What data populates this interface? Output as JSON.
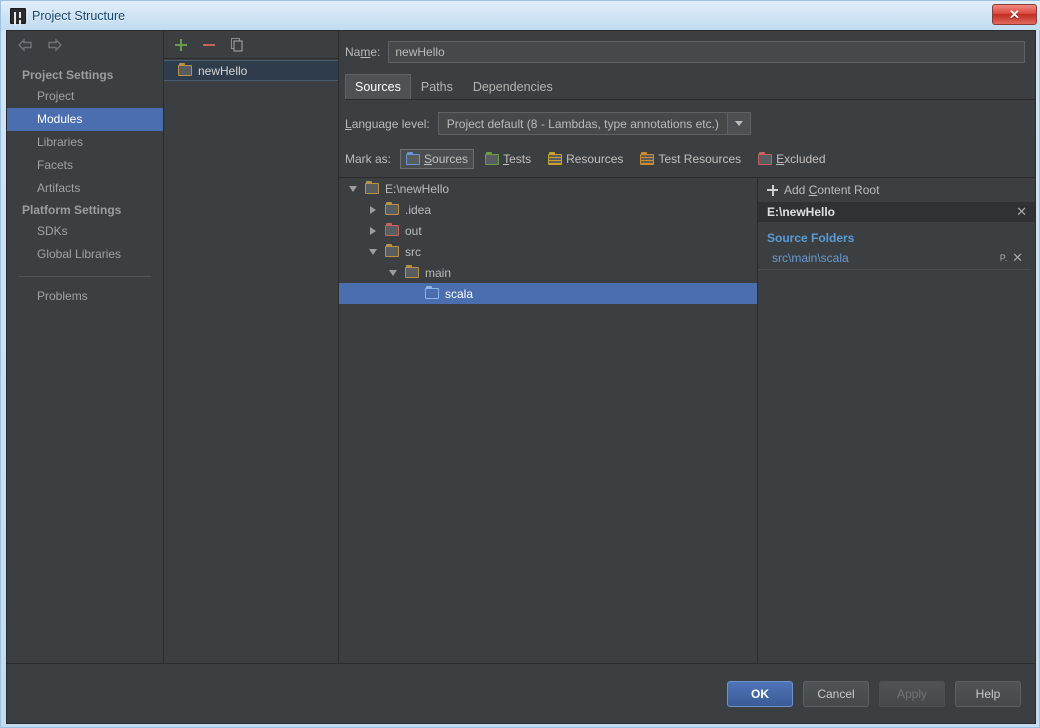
{
  "window": {
    "title": "Project Structure",
    "app_icon": "intellij-idea-icon",
    "close_label": "✕"
  },
  "sidebar": {
    "back_icon": "back-arrow-icon",
    "forward_icon": "forward-arrow-icon",
    "groups": [
      {
        "title": "Project Settings",
        "items": [
          {
            "label": "Project",
            "selected": false
          },
          {
            "label": "Modules",
            "selected": true
          },
          {
            "label": "Libraries",
            "selected": false
          },
          {
            "label": "Facets",
            "selected": false
          },
          {
            "label": "Artifacts",
            "selected": false
          }
        ]
      },
      {
        "title": "Platform Settings",
        "items": [
          {
            "label": "SDKs",
            "selected": false
          },
          {
            "label": "Global Libraries",
            "selected": false
          }
        ]
      }
    ],
    "problems_label": "Problems"
  },
  "modules_panel": {
    "toolbar": {
      "add_icon": "plus-icon",
      "remove_icon": "minus-icon",
      "copy_icon": "copy-icon"
    },
    "items": [
      {
        "label": "newHello",
        "icon": "module-folder-icon",
        "selected": true
      }
    ]
  },
  "main": {
    "name_label": "Name:",
    "name_value": "newHello",
    "name_placeholder": "",
    "tabs": [
      {
        "label": "Sources",
        "active": true
      },
      {
        "label": "Paths",
        "active": false
      },
      {
        "label": "Dependencies",
        "active": false
      }
    ],
    "language_level": {
      "label": "Language level:",
      "value": "Project default (8 - Lambdas, type annotations etc.)",
      "arrow_icon": "chevron-down-icon"
    },
    "mark_as": {
      "label": "Mark as:",
      "options": [
        {
          "label": "Sources",
          "color": "blue",
          "pressed": true
        },
        {
          "label": "Tests",
          "color": "green",
          "pressed": false
        },
        {
          "label": "Resources",
          "color": "yellow",
          "pressed": false
        },
        {
          "label": "Test Resources",
          "color": "orange",
          "pressed": false
        },
        {
          "label": "Excluded",
          "color": "red",
          "pressed": false
        }
      ]
    },
    "tree": [
      {
        "label": "E:\\newHello",
        "indent": 0,
        "twisty": "open",
        "folder": "yellow-plain",
        "selected": false
      },
      {
        "label": ".idea",
        "indent": 1,
        "twisty": "closed",
        "folder": "yellow-plain",
        "selected": false
      },
      {
        "label": "out",
        "indent": 1,
        "twisty": "closed",
        "folder": "red",
        "selected": false
      },
      {
        "label": "src",
        "indent": 1,
        "twisty": "open",
        "folder": "yellow-plain",
        "selected": false
      },
      {
        "label": "main",
        "indent": 2,
        "twisty": "open",
        "folder": "yellow-plain",
        "selected": false
      },
      {
        "label": "scala",
        "indent": 3,
        "twisty": "none",
        "folder": "plain-blue",
        "selected": true
      }
    ],
    "right_panel": {
      "add_content_root": "Add Content Root",
      "add_icon": "plus-icon",
      "content_root": "E:\\newHello",
      "content_root_remove_icon": "close-icon",
      "source_folders_title": "Source Folders",
      "source_folders": [
        {
          "path": "src\\main\\scala",
          "properties_icon": "package-prefix-icon",
          "remove_icon": "close-icon"
        }
      ]
    }
  },
  "buttons": {
    "ok": "OK",
    "cancel": "Cancel",
    "apply": "Apply",
    "help": "Help"
  },
  "colors": {
    "accent_blue": "#4b6eaf",
    "panel_bg": "#3c3f41",
    "link_blue": "#5b9bd5",
    "titlebar": "#cfe3f4"
  }
}
